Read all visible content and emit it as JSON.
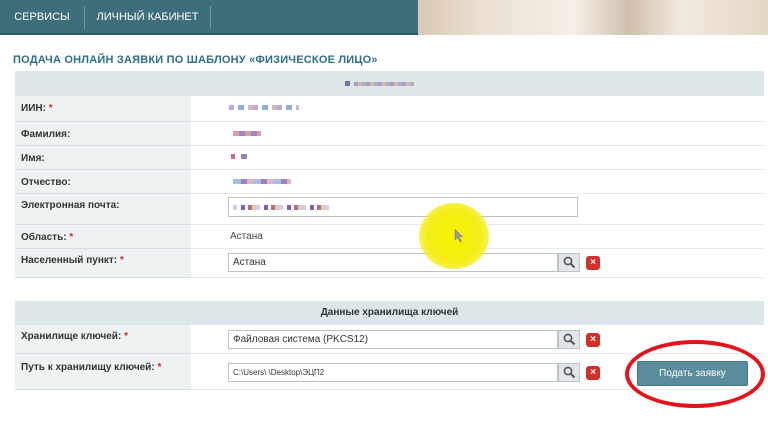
{
  "nav": {
    "items": [
      {
        "label": "СЕРВИСЫ"
      },
      {
        "label": "ЛИЧНЫЙ КАБИНЕТ"
      }
    ]
  },
  "page": {
    "title": "ПОДАЧА ОНЛАЙН ЗАЯВКИ ПО ШАБЛОНУ «ФИЗИЧЕСКОЕ ЛИЦО»"
  },
  "personal": {
    "fields": [
      {
        "label": "ИИН:",
        "required": "*"
      },
      {
        "label": "Фамилия:"
      },
      {
        "label": "Имя:"
      },
      {
        "label": "Отчество:"
      },
      {
        "label": "Электронная почта:"
      },
      {
        "label": "Область:",
        "required": "*",
        "value": "Астана"
      },
      {
        "label": "Населенный пункт:",
        "required": "*",
        "value": "Астана"
      }
    ]
  },
  "keystore": {
    "header": "Данные хранилища ключей",
    "storage_label": "Хранилище ключей:",
    "storage_required": "*",
    "storage_value": "Файловая система (PKCS12)",
    "path_label": "Путь к хранилищу ключей:",
    "path_required": "*",
    "path_value": "C:\\Users\\  \\Desktop\\ЭЦП2"
  },
  "actions": {
    "submit_label": "Подать заявку"
  },
  "colors": {
    "nav_bg": "#3d6e7c",
    "accent_title": "#2d6f86",
    "panel_header": "#dde7ea",
    "required": "#d9271f",
    "submit_bg": "#5a8c9c",
    "annotation": "#e3131b",
    "cursor_highlight": "#f6f200"
  }
}
